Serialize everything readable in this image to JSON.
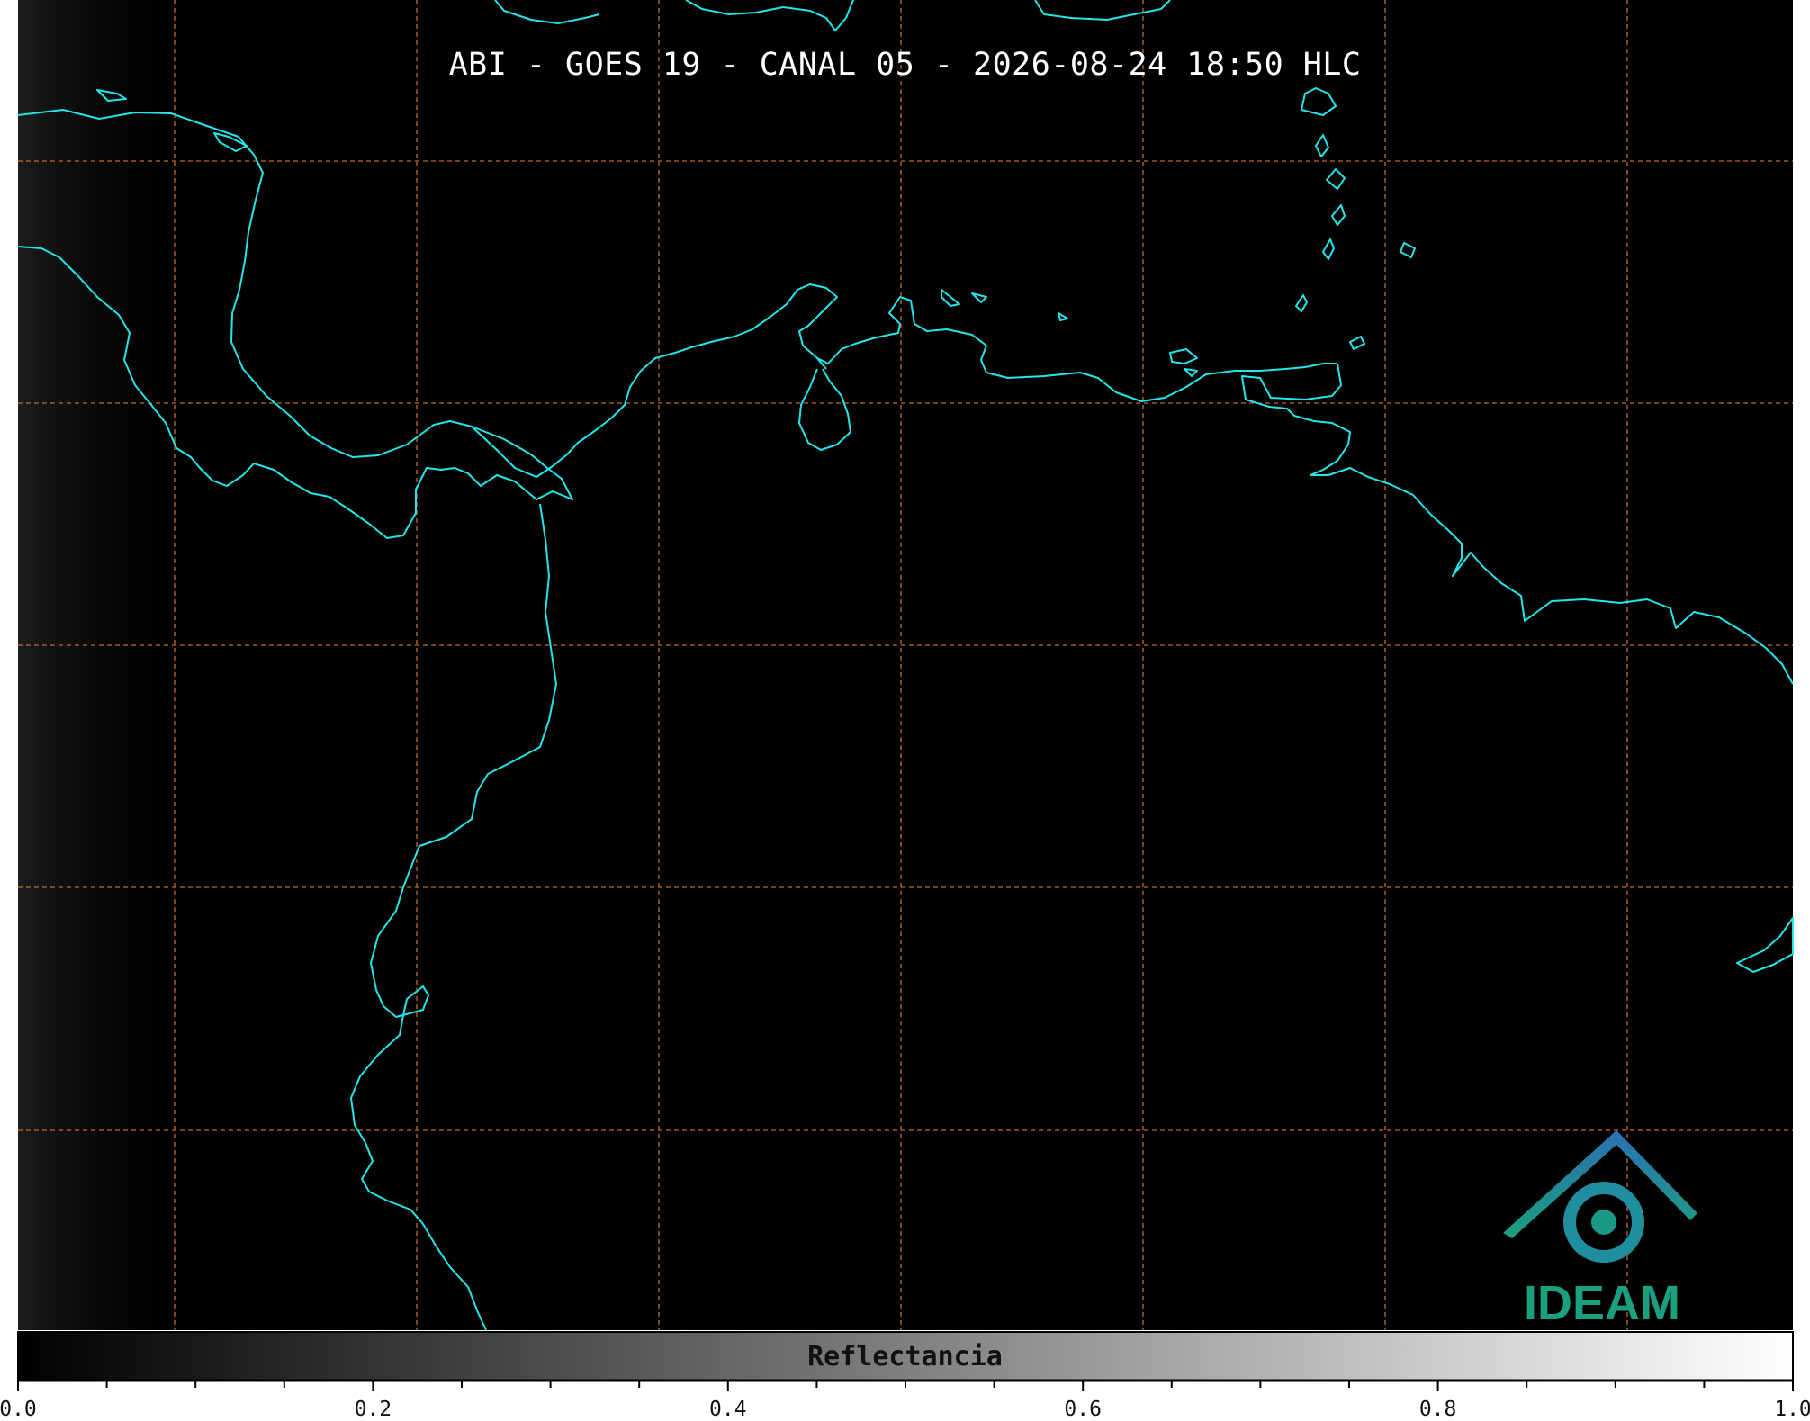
{
  "title": "ABI - GOES 19 - CANAL 05 - 2026-08-24 18:50 HLC",
  "colors": {
    "background": "#000000",
    "coastline": "#22e6ea",
    "grid": "#c8682a",
    "logo_green": "#1aa07c",
    "logo_blue": "#2b6fb3"
  },
  "colorbar": {
    "label": "Reflectancia",
    "min": 0.0,
    "max": 1.0,
    "colormap": "grayscale (black to white)",
    "tick_labels": [
      "0.0",
      "0.2",
      "0.4",
      "0.6",
      "0.8",
      "1.0"
    ]
  },
  "logo": {
    "text": "IDEAM"
  },
  "map": {
    "grid": true,
    "grid_style": "dashed"
  }
}
